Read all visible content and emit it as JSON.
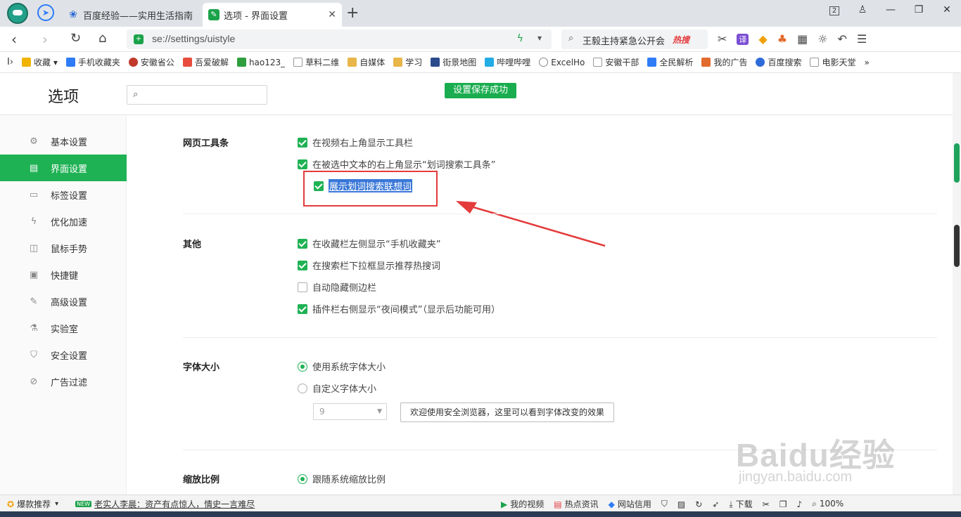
{
  "tabs": [
    {
      "label": "百度经验——实用生活指南",
      "active": false
    },
    {
      "label": "选项 - 界面设置",
      "active": true
    }
  ],
  "tab_icons": {
    "new_tab": "plus-icon",
    "close": "close-icon"
  },
  "window_controls": {
    "tab_count": "2"
  },
  "address": {
    "url": "se://settings/uistyle"
  },
  "search": {
    "text": "王毅主持紧急公开会",
    "badge": "热搜"
  },
  "bookmarks": [
    {
      "label": "收藏",
      "color": "#f0b400"
    },
    {
      "label": "手机收藏夹",
      "color": "#2e7cf6"
    },
    {
      "label": "安徽省公",
      "color": "#c0392b"
    },
    {
      "label": "吾爱破解",
      "color": "#e74c3c"
    },
    {
      "label": "hao123_",
      "color": "#2e9e3e"
    },
    {
      "label": "草料二维",
      "color": "#999999"
    },
    {
      "label": "自媒体",
      "color": "#e9b64a"
    },
    {
      "label": "学习",
      "color": "#e9b64a"
    },
    {
      "label": "街景地图",
      "color": "#2b4a8b"
    },
    {
      "label": "哔哩哔哩",
      "color": "#23ade5"
    },
    {
      "label": "ExcelHo",
      "color": "#888888"
    },
    {
      "label": "安徽干部",
      "color": "#999999"
    },
    {
      "label": "全民解析",
      "color": "#2e7cf6"
    },
    {
      "label": "我的广告",
      "color": "#e26a2c"
    },
    {
      "label": "百度搜索",
      "color": "#2f6bd8"
    },
    {
      "label": "电影天堂",
      "color": "#999999"
    }
  ],
  "bookmarks_more": "»",
  "header": {
    "title": "选项",
    "toast": "设置保存成功",
    "search_placeholder": ""
  },
  "sidebar": {
    "items": [
      {
        "label": "基本设置",
        "icon": "gear-icon",
        "glyph": "⚙",
        "active": false
      },
      {
        "label": "界面设置",
        "icon": "window-icon",
        "glyph": "▤",
        "active": true
      },
      {
        "label": "标签设置",
        "icon": "tab-icon",
        "glyph": "▭",
        "active": false
      },
      {
        "label": "优化加速",
        "icon": "lightning-icon",
        "glyph": "ϟ",
        "active": false
      },
      {
        "label": "鼠标手势",
        "icon": "mouse-icon",
        "glyph": "◫",
        "active": false
      },
      {
        "label": "快捷键",
        "icon": "keyboard-icon",
        "glyph": "▣",
        "active": false
      },
      {
        "label": "高级设置",
        "icon": "wrench-icon",
        "glyph": "✎",
        "active": false
      },
      {
        "label": "实验室",
        "icon": "flask-icon",
        "glyph": "⚗",
        "active": false
      },
      {
        "label": "安全设置",
        "icon": "shield-icon",
        "glyph": "⛉",
        "active": false
      },
      {
        "label": "广告过滤",
        "icon": "block-icon",
        "glyph": "⊘",
        "active": false
      }
    ]
  },
  "sections": {
    "toolbar": {
      "label": "网页工具条",
      "opt1": "在视频右上角显示工具栏",
      "opt2": "在被选中文本的右上角显示“划词搜索工具条”",
      "opt3": "展示划词搜索联想词"
    },
    "other": {
      "label": "其他",
      "opt1": "在收藏栏左侧显示“手机收藏夹”",
      "opt2": "在搜索栏下拉框显示推荐热搜词",
      "opt3": "自动隐藏侧边栏",
      "opt4": "插件栏右侧显示“夜间模式”（显示后功能可用）"
    },
    "font": {
      "label": "字体大小",
      "opt1": "使用系统字体大小",
      "opt2": "自定义字体大小",
      "size_value": "9",
      "preview": "欢迎使用安全浏览器，这里可以看到字体改变的效果"
    },
    "zoom": {
      "label": "缩放比例",
      "opt1": "跟随系统缩放比例"
    }
  },
  "colors": {
    "accent": "#1fb254",
    "annotation": "#e43b3b",
    "selection": "#3a78d8"
  },
  "watermark": {
    "brand": "Baidu经验",
    "url": "jingyan.baidu.com"
  },
  "statusbar": {
    "hot": "爆款推荐",
    "news_badge": "NEW",
    "news": "老实人李晨：资产有点惊人，情史一言难尽",
    "video": "我的视频",
    "hotnews": "热点资讯",
    "credit": "网站信用",
    "download": "下载",
    "zoom": "100%"
  }
}
